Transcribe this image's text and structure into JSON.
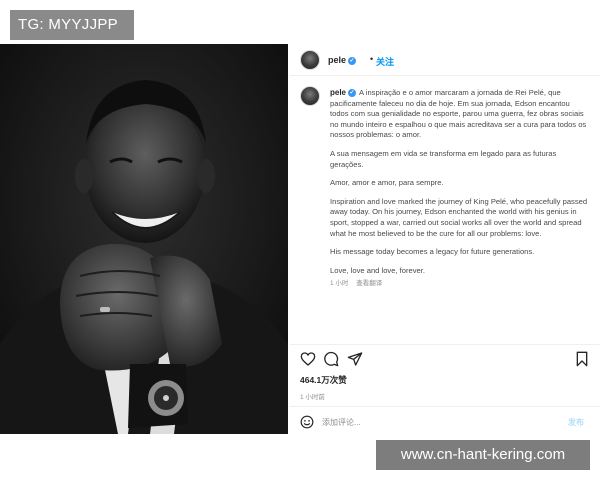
{
  "overlay": {
    "tg_label": "TG: MYYJJPP",
    "watermark": "www.cn-hant-kering.com"
  },
  "post": {
    "header": {
      "username": "pele",
      "verified_mark": "✓",
      "separator": "•",
      "follow_label": "关注"
    },
    "caption": {
      "username": "pele",
      "paragraphs": [
        "A inspiração e o amor marcaram a jornada de Rei Pelé, que pacificamente faleceu no dia de hoje. Em sua jornada, Edson encantou todos com sua genialidade no esporte, parou uma guerra, fez obras sociais no mundo inteiro e espalhou o que mais acreditava ser a cura para todos os nossos problemas: o amor.",
        "A sua mensagem em vida se transforma em legado para as futuras gerações.",
        "Amor, amor e amor, para sempre.",
        "Inspiration and love marked the journey of King Pelé, who peacefully passed away today. On his journey, Edson enchanted the world with his genius in sport, stopped a war, carried out social works all over the world and spread what he most believed to be the cure for all our problems: love.",
        "His message today becomes a legacy for future generations.",
        "Love, love and love, forever."
      ],
      "meta_time": "1 小时",
      "meta_translate": "查看翻译"
    },
    "actions": {
      "like_icon": "heart-icon",
      "comment_icon": "comment-icon",
      "share_icon": "share-icon",
      "save_icon": "bookmark-icon"
    },
    "likes": "464.1万次赞",
    "timestamp": "1 小时前",
    "comment": {
      "placeholder": "添加评论...",
      "post_label": "发布"
    }
  },
  "colors": {
    "link_blue": "#0095f6",
    "verified_blue": "#3897f0",
    "overlay_gray": "#8a8a8a"
  }
}
